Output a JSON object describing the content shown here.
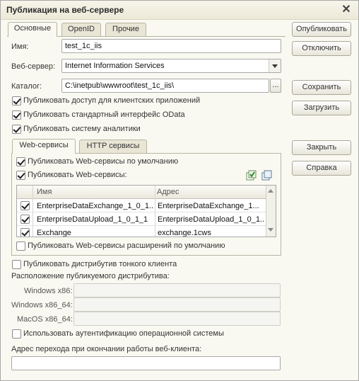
{
  "window": {
    "title": "Публикация на веб-сервере"
  },
  "tabs": [
    "Основные",
    "OpenID",
    "Прочие"
  ],
  "form": {
    "name_label": "Имя:",
    "name_value": "test_1c_iis",
    "server_label": "Веб-сервер:",
    "server_value": "Internet Information Services",
    "dir_label": "Каталог:",
    "dir_value": "C:\\inetpub\\wwwroot\\test_1c_iis\\",
    "dir_browse": "..."
  },
  "options": [
    {
      "label": "Публиковать доступ для клиентских приложений",
      "checked": true
    },
    {
      "label": "Публиковать стандартный интерфейс OData",
      "checked": true
    },
    {
      "label": "Публиковать систему аналитики",
      "checked": true
    }
  ],
  "subtabs": [
    "Web-сервисы",
    "HTTP сервисы"
  ],
  "ws": {
    "default_label": "Публиковать Web-сервисы по умолчанию",
    "publish_label": "Публиковать Web-сервисы:",
    "col_name": "Имя",
    "col_address": "Адрес",
    "rows": [
      {
        "name": "EnterpriseDataExchange_1_0_1...",
        "address": "EnterpriseDataExchange_1...",
        "checked": true
      },
      {
        "name": "EnterpriseDataUpload_1_0_1_1",
        "address": "EnterpriseDataUpload_1_0_1...",
        "checked": true
      },
      {
        "name": "Exchange",
        "address": "exchange.1cws",
        "checked": true
      }
    ],
    "ext_label": "Публиковать Web-сервисы расширений по умолчанию"
  },
  "thin": {
    "publish_label": "Публиковать дистрибутив тонкого клиента",
    "location_label": "Расположение публикуемого дистрибутива:",
    "x86_label": "Windows x86:",
    "x64_label": "Windows x86_64:",
    "mac_label": "MacOS x86_64:"
  },
  "auth_label": "Использовать аутентификацию операционной системы",
  "redirect_label": "Адрес перехода при окончании работы веб-клиента:",
  "buttons": {
    "publish": "Опубликовать",
    "disable": "Отключить",
    "save": "Сохранить",
    "load": "Загрузить",
    "close": "Закрыть",
    "help": "Справка"
  },
  "colors": {
    "window_bg": "#faf9f1",
    "border": "#a7a7a7",
    "icon_green": "#3a9a3a"
  }
}
